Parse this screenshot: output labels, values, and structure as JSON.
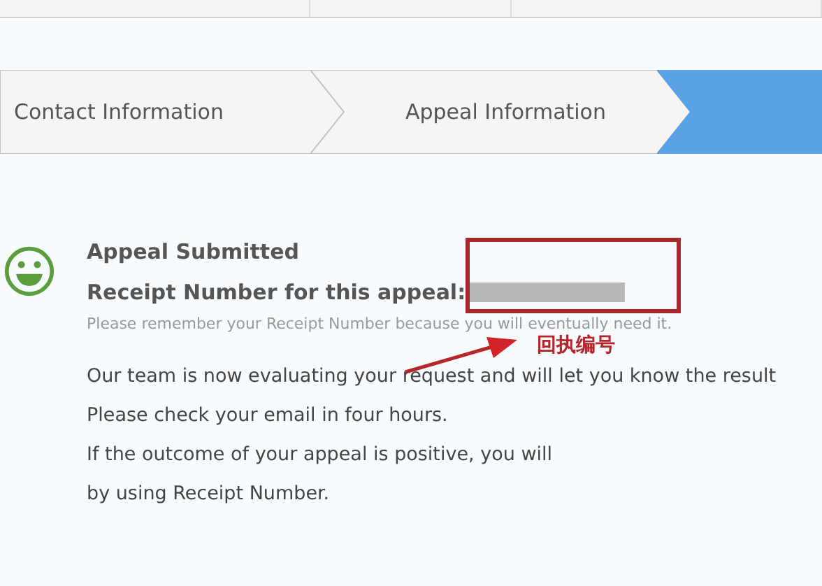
{
  "steps": [
    {
      "label": "Contact Information",
      "selected": false
    },
    {
      "label": "Appeal Information",
      "selected": false
    },
    {
      "selected": true
    }
  ],
  "result": {
    "title": "Appeal Submitted",
    "receipt_label": "Receipt Number for this appeal:",
    "hint": "Please remember your Receipt Number because you will eventually need it.",
    "lines": [
      "Our team is now evaluating your request and will let you know the result",
      "Please check your email in four hours.",
      "If the outcome of your appeal is positive, you will",
      "by using Receipt Number."
    ]
  },
  "annotation": {
    "label": "回执编号"
  }
}
